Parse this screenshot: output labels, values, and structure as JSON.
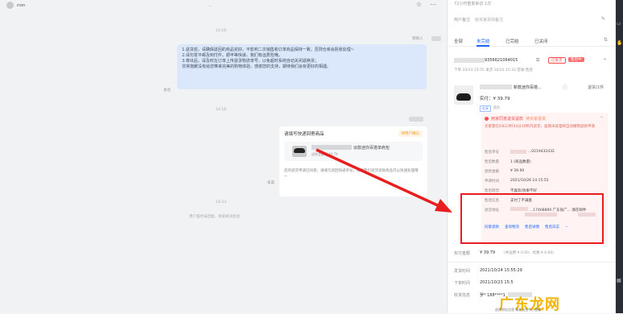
{
  "chat": {
    "contact_name": "non",
    "timestamps": [
      "14:18",
      "14:18",
      "14:33"
    ],
    "sender_label_1": "萌萌人",
    "bubble_lines": [
      "1.退货前，请确保退回的商品完好，不影响二次销售和订单商品保持一致，否则仓库会拒收处理~",
      "2.请勿发平邮及到付件，顺丰等快递，我们有运费险哦。",
      "3.寄出后，请及时在订单上传退货物流单号，以免超时系统自动关闭退换货；",
      "非常抱歉没有给您带来完美的购物体验，感谢您的支持，期待我们会有更好的相遇。"
    ],
    "left_label_1": "会话",
    "left_label_2": "朱晨",
    "card": {
      "title": "请填写快递回寄商品",
      "tag": "待用户确认",
      "product_name": "派款迷你百搭单肩包",
      "product_sub": "退款金额 ¥ 39.79",
      "description": "您的退货申请已同意，请填写退回快递单号，以便我们退货退款商品可以快速处理哦~"
    },
    "system_message": "用户超时未回复，系统关闭会话"
  },
  "right_panel": {
    "top_text": "72小时重复来访 1次",
    "note_label": "用户备注",
    "note_placeholder": "给买家添加备注",
    "tabs": [
      "全部",
      "未完结",
      "已完结",
      "已关闭"
    ],
    "active_tab": "未完结",
    "order": {
      "order_id": "9356621064015",
      "badge_1": "已发货",
      "badge_2": "售后中",
      "order_time": "下单 10/23 15:55 发货 10/22 15:33 签收 售后",
      "product_name": "新款迷你百搭...",
      "product_count": "退货/1件",
      "price": "实付：¥ 39.79",
      "tag_1": "七天",
      "tag_2": "黑色",
      "refund": {
        "status": "用家同意退货退款",
        "substatus": "待买家退货",
        "desc": "买家需在6天23时34分16秒内退货，逾期未处理将自动撤销退款申请",
        "rows": [
          {
            "label": "售后单号",
            "value": "...0219432432"
          },
          {
            "label": "售后数量",
            "value": "1 (商品数量)"
          },
          {
            "label": "退款金额",
            "value": "¥ 39.90"
          },
          {
            "label": "申请时间",
            "value": "2021/10/26 14:15:55"
          },
          {
            "label": "售后原因",
            "value": "不喜欢/效果不好"
          },
          {
            "label": "售后信息",
            "value": "支付了不满意"
          },
          {
            "label": "退货地址",
            "value": "...17408890 广东省广... 请在邮件"
          }
        ],
        "actions": [
          "同意退款",
          "查询物流",
          "售后详情",
          "售后日志",
          "⌄"
        ]
      }
    },
    "paid_label": "实付金额",
    "paid_value": "¥ 39.79",
    "paid_detail": "(共运费 ¥ 0.00，优惠 ¥ 0.00)",
    "info": [
      {
        "label": "发货时间",
        "value": "2021/10/24 15:55:29"
      },
      {
        "label": "下单时间",
        "value": "2021/10/23 15:5"
      },
      {
        "label": "收货信息",
        "value": "罗* 188****1"
      }
    ]
  },
  "watermark": {
    "text": "广东龙网",
    "sub": "退货地址信息 请在退货中心查看"
  }
}
